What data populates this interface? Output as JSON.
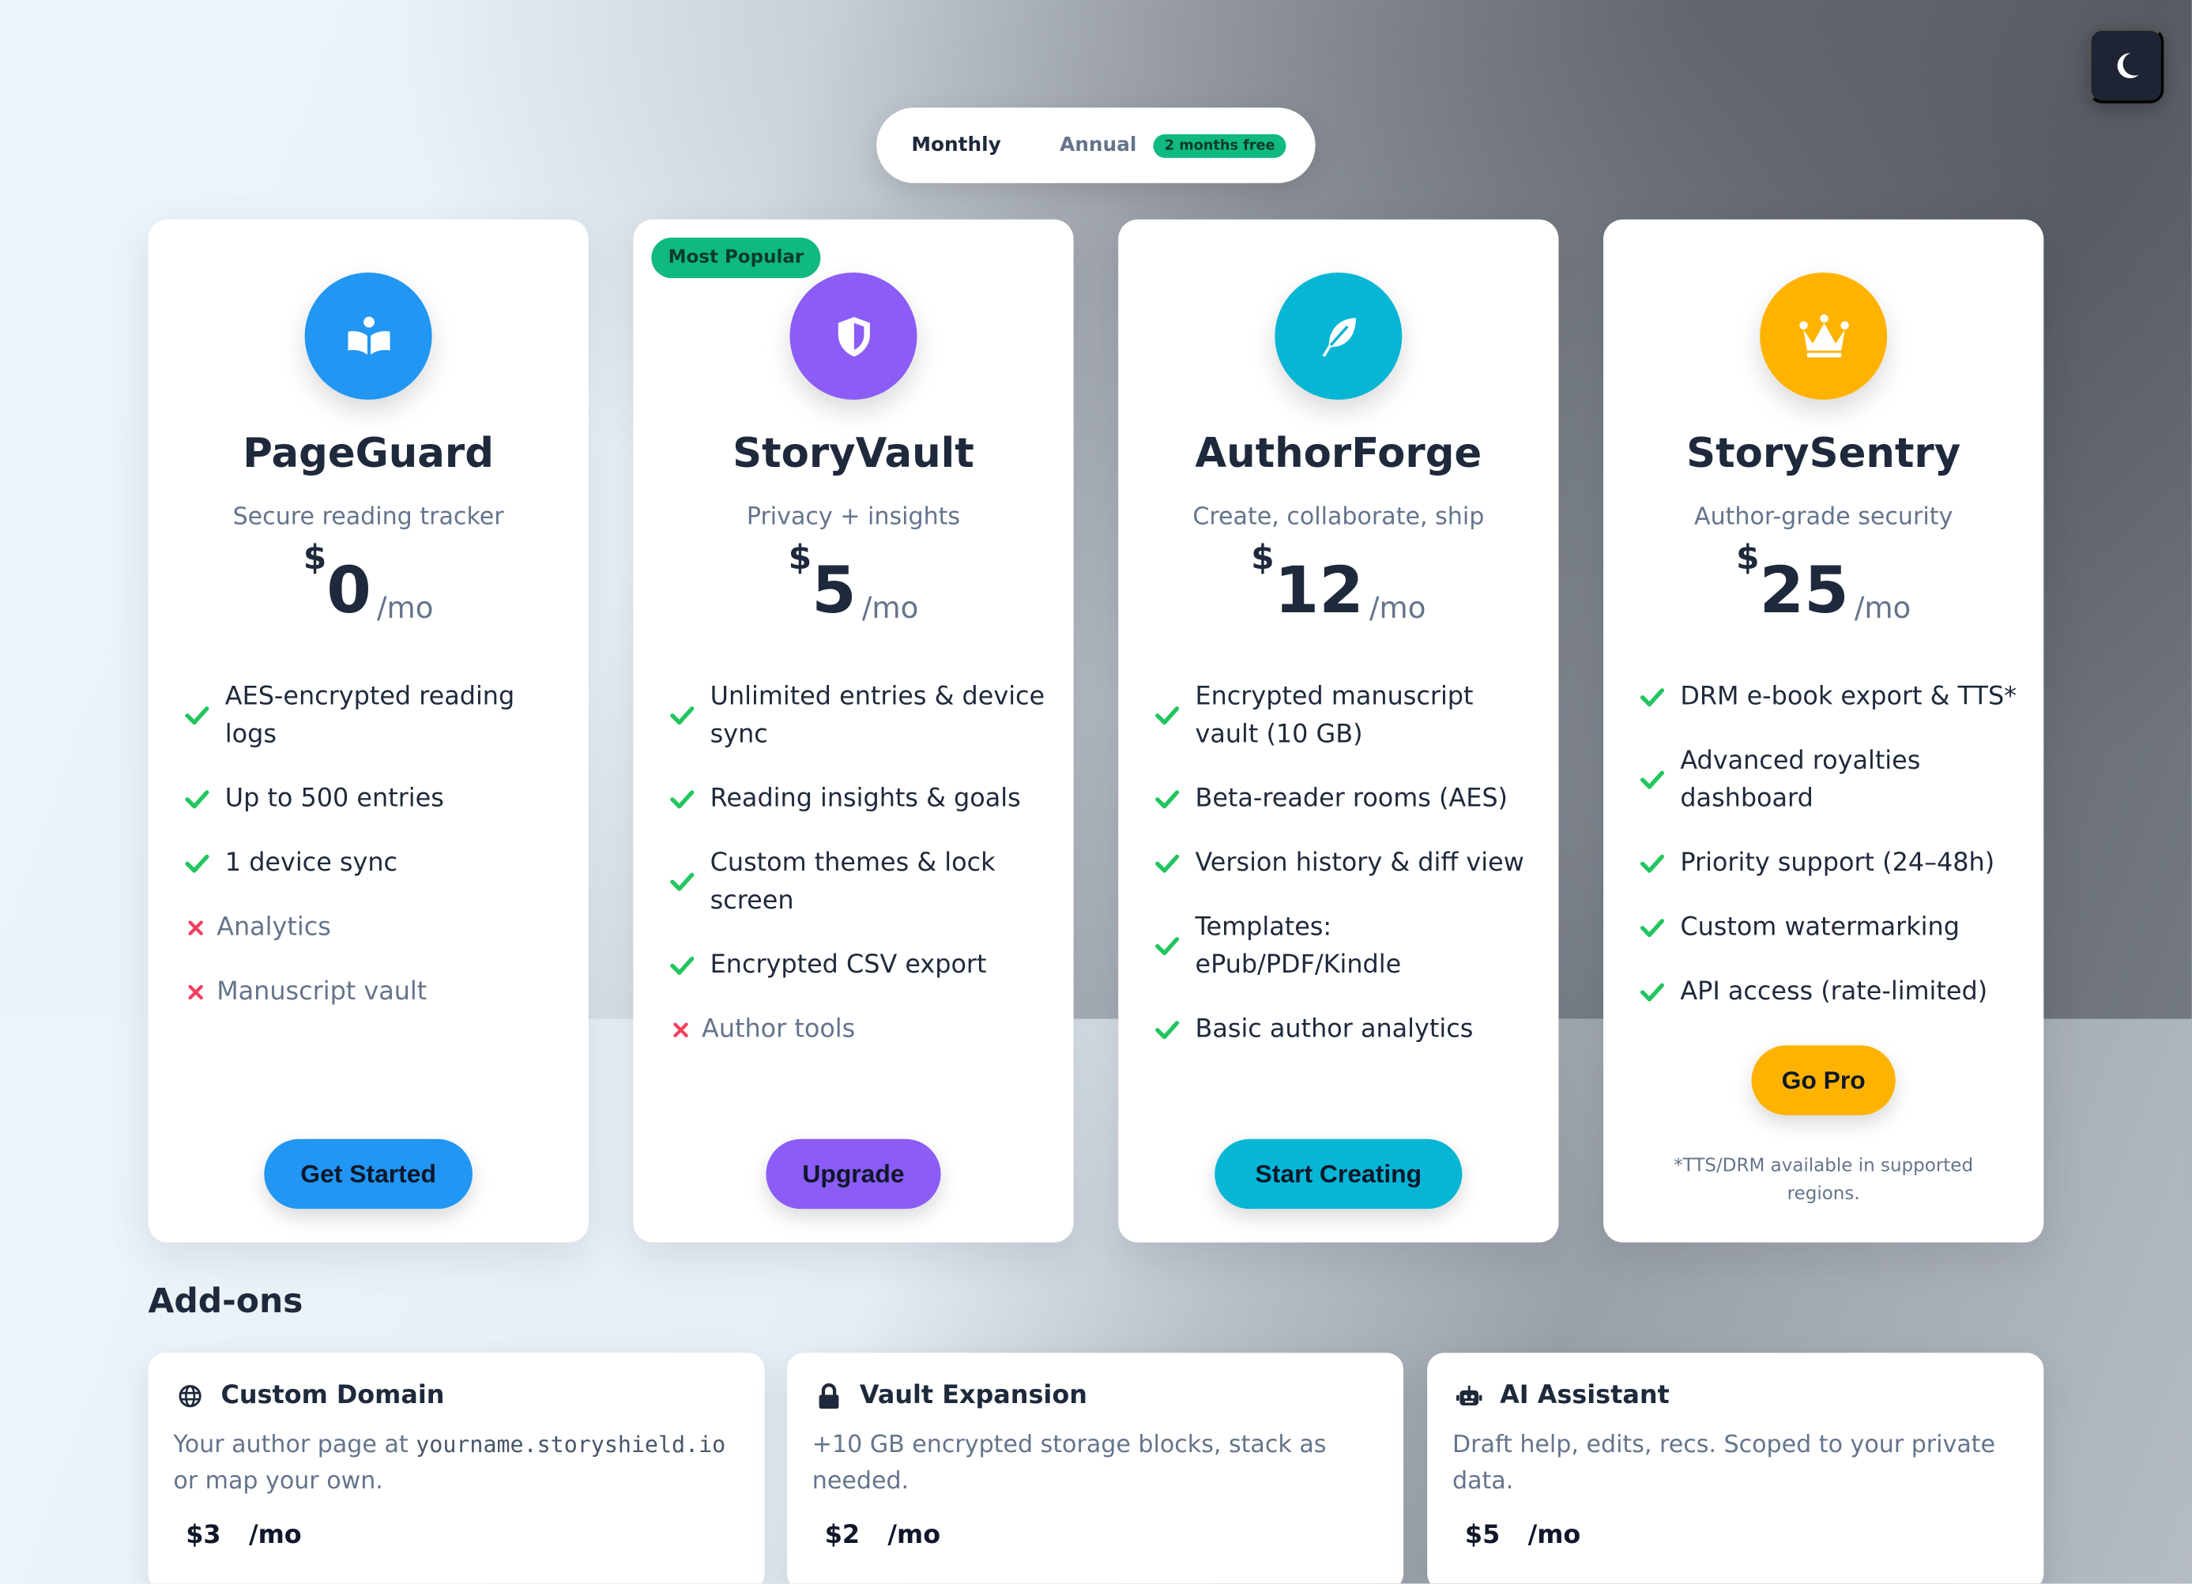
{
  "billing_toggle": {
    "monthly": "Monthly",
    "annual": "Annual",
    "annual_badge": "2 months free"
  },
  "theme_toggle": {
    "icon": "moon-icon"
  },
  "plans": [
    {
      "name": "PageGuard",
      "tagline": "Secure reading tracker",
      "currency": "$",
      "price": "0",
      "period": "/mo",
      "icon": "book-reader-icon",
      "color": "#2196f3",
      "features": [
        {
          "text": "AES-encrypted reading logs",
          "included": true
        },
        {
          "text": "Up to 500 entries",
          "included": true
        },
        {
          "text": "1 device sync",
          "included": true
        },
        {
          "text": "Analytics",
          "included": false
        },
        {
          "text": "Manuscript vault",
          "included": false
        }
      ],
      "cta": "Get Started"
    },
    {
      "name": "StoryVault",
      "tagline": "Privacy + insights",
      "currency": "$",
      "price": "5",
      "period": "/mo",
      "icon": "shield-icon",
      "color": "#8b5cf6",
      "badge": "Most Popular",
      "features": [
        {
          "text": "Unlimited entries & device sync",
          "included": true
        },
        {
          "text": "Reading insights & goals",
          "included": true
        },
        {
          "text": "Custom themes & lock screen",
          "included": true
        },
        {
          "text": "Encrypted CSV export",
          "included": true
        },
        {
          "text": "Author tools",
          "included": false
        }
      ],
      "cta": "Upgrade"
    },
    {
      "name": "AuthorForge",
      "tagline": "Create, collaborate, ship",
      "currency": "$",
      "price": "12",
      "period": "/mo",
      "icon": "feather-icon",
      "color": "#06b6d4",
      "features": [
        {
          "text": "Encrypted manuscript vault (10 GB)",
          "included": true
        },
        {
          "text": "Beta-reader rooms (AES)",
          "included": true
        },
        {
          "text": "Version history & diff view",
          "included": true
        },
        {
          "text": "Templates: ePub/PDF/Kindle",
          "included": true
        },
        {
          "text": "Basic author analytics",
          "included": true
        }
      ],
      "cta": "Start Creating"
    },
    {
      "name": "StorySentry",
      "tagline": "Author-grade security",
      "currency": "$",
      "price": "25",
      "period": "/mo",
      "icon": "crown-icon",
      "color": "#ffb300",
      "features": [
        {
          "text": "DRM e-book export & TTS*",
          "included": true
        },
        {
          "text": "Advanced royalties dashboard",
          "included": true
        },
        {
          "text": "Priority support (24–48h)",
          "included": true
        },
        {
          "text": "Custom watermarking",
          "included": true
        },
        {
          "text": "API access (rate-limited)",
          "included": true
        }
      ],
      "cta": "Go Pro",
      "note": "*TTS/DRM available in supported regions."
    }
  ],
  "addons": {
    "heading": "Add-ons",
    "items": [
      {
        "title": "Custom Domain",
        "icon": "globe-icon",
        "desc_pre": "Your author page at ",
        "desc_code": "yourname.storyshield.io",
        "desc_post": " or map your own.",
        "price": "$3",
        "period": "/mo"
      },
      {
        "title": "Vault Expansion",
        "icon": "lock-icon",
        "desc": "+10 GB encrypted storage blocks, stack as needed.",
        "price": "$2",
        "period": "/mo"
      },
      {
        "title": "AI Assistant",
        "icon": "robot-icon",
        "desc": "Draft help, edits, recs. Scoped to your private data.",
        "price": "$5",
        "period": "/mo"
      }
    ]
  }
}
